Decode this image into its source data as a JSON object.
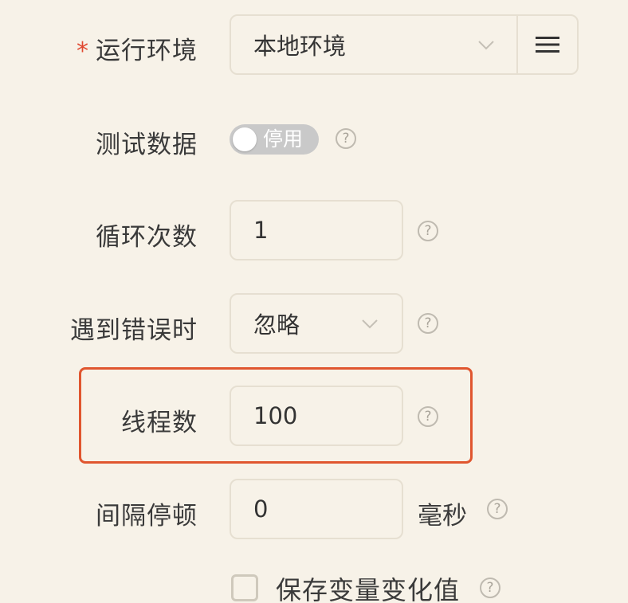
{
  "form": {
    "env": {
      "required_mark": "*",
      "label": "运行环境",
      "value": "本地环境"
    },
    "test_data": {
      "label": "测试数据",
      "switch_text": "停用",
      "enabled": false
    },
    "loop_count": {
      "label": "循环次数",
      "value": "1"
    },
    "on_error": {
      "label": "遇到错误时",
      "value": "忽略"
    },
    "threads": {
      "label": "线程数",
      "value": "100"
    },
    "interval": {
      "label": "间隔停顿",
      "value": "0",
      "unit": "毫秒"
    },
    "save_vars": {
      "label": "保存变量变化值",
      "checked": false
    },
    "help_glyph": "?"
  },
  "colors": {
    "background": "#f7f2e8",
    "highlight_border": "#e0562f",
    "required": "#e0472f",
    "switch_off": "#c9c9c9"
  },
  "icons": [
    "chevron-down-icon",
    "menu-icon",
    "help-icon"
  ]
}
